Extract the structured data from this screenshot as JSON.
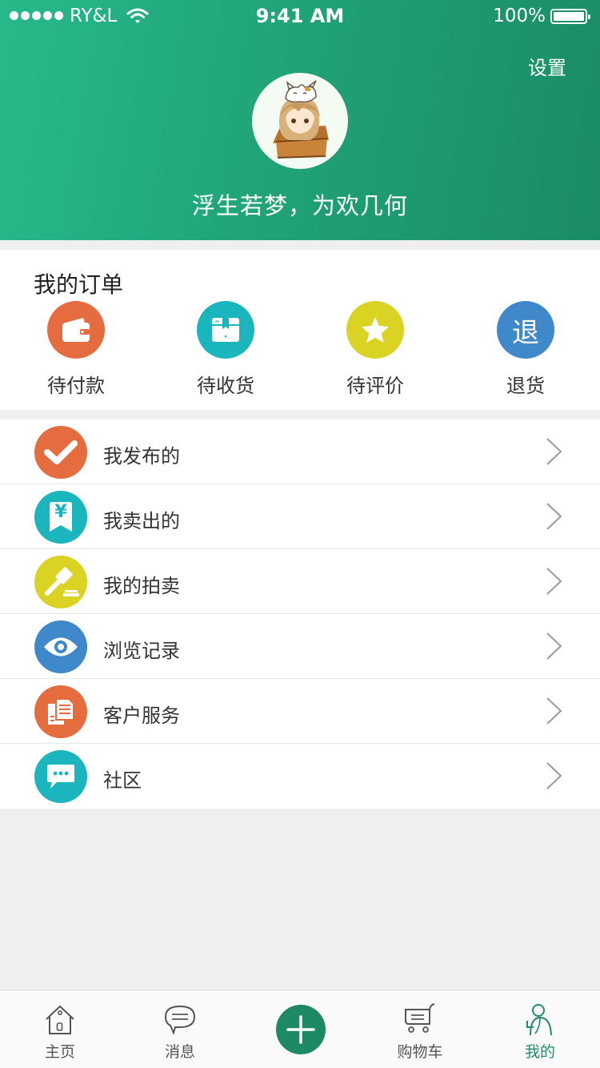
{
  "status_bar": {
    "carrier": "RY&L",
    "time": "9:41 AM",
    "battery": "100%"
  },
  "header": {
    "settings_label": "设置",
    "nickname": "浮生若梦，为欢几何"
  },
  "orders": {
    "title": "我的订单",
    "items": [
      {
        "label": "待付款",
        "icon": "wallet-icon",
        "color": "#e46c3f"
      },
      {
        "label": "待收货",
        "icon": "box-icon",
        "color": "#1ab5bd"
      },
      {
        "label": "待评价",
        "icon": "star-icon",
        "color": "#dbd323"
      },
      {
        "label": "退货",
        "icon": "return-icon",
        "glyph": "退",
        "color": "#3f88c9"
      }
    ]
  },
  "menu": [
    {
      "label": "我发布的",
      "icon": "check-icon",
      "color": "#e46c3f"
    },
    {
      "label": "我卖出的",
      "icon": "yen-tag-icon",
      "glyph": "¥",
      "color": "#1ab5bd"
    },
    {
      "label": "我的拍卖",
      "icon": "gavel-icon",
      "color": "#dbd323"
    },
    {
      "label": "浏览记录",
      "icon": "eye-icon",
      "color": "#3f88c9"
    },
    {
      "label": "客户服务",
      "icon": "documents-icon",
      "color": "#e46c3f"
    },
    {
      "label": "社区",
      "icon": "chat-bubble-icon",
      "color": "#1ab5bd"
    }
  ],
  "tabbar": {
    "items": [
      {
        "label": "主页",
        "icon": "home-icon",
        "active": false
      },
      {
        "label": "消息",
        "icon": "message-icon",
        "active": false
      },
      {
        "label": "",
        "icon": "plus-icon",
        "active": false
      },
      {
        "label": "购物车",
        "icon": "cart-icon",
        "active": false
      },
      {
        "label": "我的",
        "icon": "profile-icon",
        "active": true
      }
    ],
    "active_color": "#1e8f67"
  },
  "colors": {
    "header_green": "#22ac7e",
    "orange": "#e46c3f",
    "teal": "#1ab5bd",
    "yellow": "#dbd323",
    "blue": "#3f88c9"
  }
}
